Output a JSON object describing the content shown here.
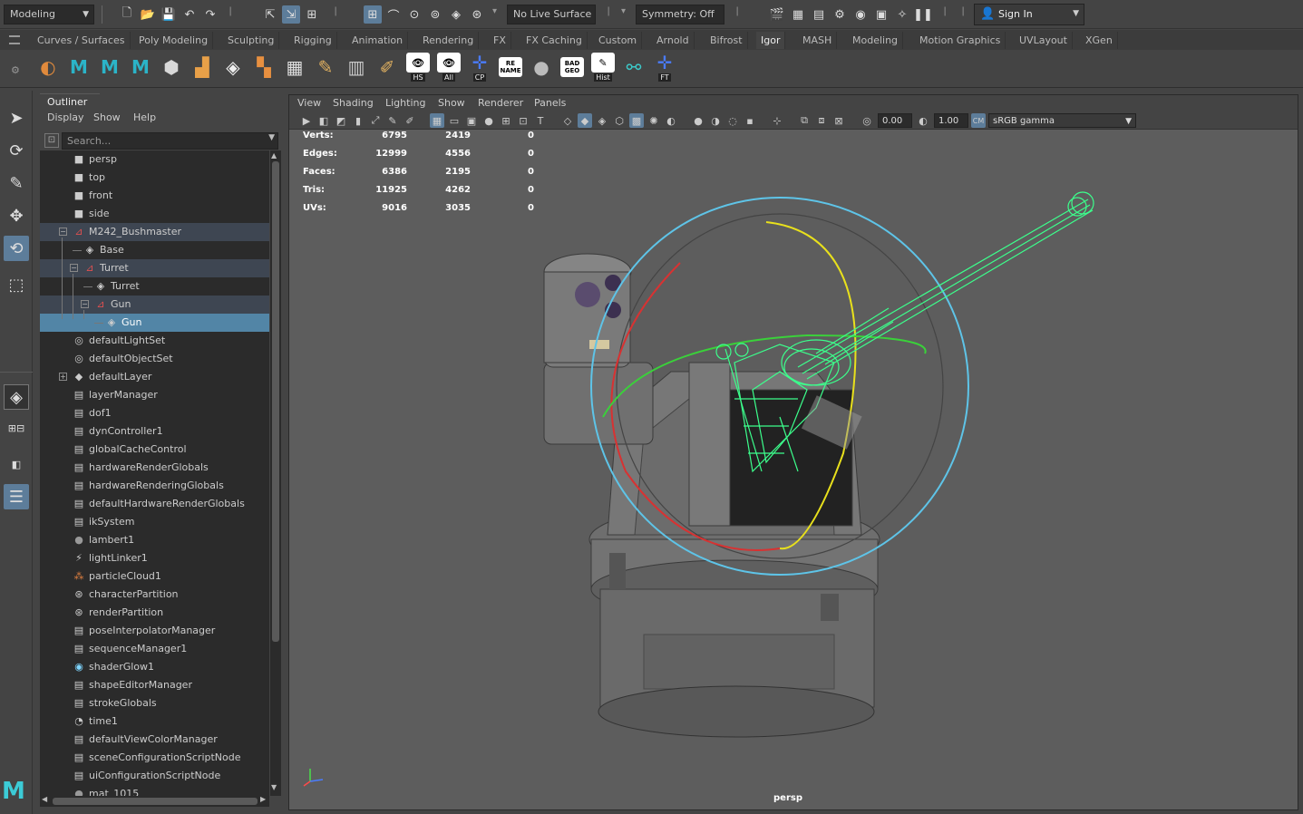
{
  "statusline": {
    "mode": "Modeling",
    "live_surface": "No Live Surface",
    "symmetry": "Symmetry: Off",
    "sign_in": "Sign In"
  },
  "shelf_tabs": [
    "Curves / Surfaces",
    "Poly Modeling",
    "Sculpting",
    "Rigging",
    "Animation",
    "Rendering",
    "FX",
    "FX Caching",
    "Custom",
    "Arnold",
    "Bifrost",
    "Igor",
    "MASH",
    "Modeling",
    "Motion Graphics",
    "UVLayout",
    "XGen"
  ],
  "active_shelf_tab": "Igor",
  "shelf_buttons": [
    {
      "icon": "shelf-ball-icon",
      "label": ""
    },
    {
      "icon": "shelf-m-icon-1",
      "label": ""
    },
    {
      "icon": "shelf-m-icon-2",
      "label": ""
    },
    {
      "icon": "shelf-m-icon-3",
      "label": ""
    },
    {
      "icon": "shelf-cube-icon",
      "label": ""
    },
    {
      "icon": "shelf-blocks-icon",
      "label": ""
    },
    {
      "icon": "shelf-layers-icon",
      "label": ""
    },
    {
      "icon": "shelf-squares-icon",
      "label": ""
    },
    {
      "icon": "shelf-grid-icon",
      "label": ""
    },
    {
      "icon": "shelf-pencil-icon",
      "label": ""
    },
    {
      "icon": "shelf-bars-icon",
      "label": ""
    },
    {
      "icon": "shelf-paint-icon",
      "label": ""
    },
    {
      "icon": "shelf-eye-icon",
      "label": "HS"
    },
    {
      "icon": "shelf-eye-all-icon",
      "label": "All"
    },
    {
      "icon": "shelf-axis-icon",
      "label": "CP"
    },
    {
      "icon": "shelf-rename-icon",
      "label": "",
      "text": "RE NAME"
    },
    {
      "icon": "shelf-sphere-icon",
      "label": ""
    },
    {
      "icon": "shelf-badgeo-icon",
      "label": "",
      "text": "BAD GEO"
    },
    {
      "icon": "shelf-hist-icon",
      "label": "Hist"
    },
    {
      "icon": "shelf-attach-icon",
      "label": ""
    },
    {
      "icon": "shelf-ft-icon",
      "label": "FT"
    }
  ],
  "outliner": {
    "tab": "Outliner",
    "menu": [
      "Display",
      "Show",
      "Help"
    ],
    "search_placeholder": "Search...",
    "rows": [
      {
        "label": "persp",
        "icon": "camera-icon",
        "indent": 0,
        "state": ""
      },
      {
        "label": "top",
        "icon": "camera-icon",
        "indent": 0,
        "state": ""
      },
      {
        "label": "front",
        "icon": "camera-icon",
        "indent": 0,
        "state": ""
      },
      {
        "label": "side",
        "icon": "camera-icon",
        "indent": 0,
        "state": ""
      },
      {
        "label": "M242_Bushmaster",
        "icon": "group-icon",
        "indent": 0,
        "state": "hl",
        "expander": "−"
      },
      {
        "label": "Base",
        "icon": "mesh-icon",
        "indent": 1,
        "state": ""
      },
      {
        "label": "Turret",
        "icon": "group-icon",
        "indent": 1,
        "state": "hl",
        "expander": "−"
      },
      {
        "label": "Turret",
        "icon": "mesh-icon",
        "indent": 2,
        "state": ""
      },
      {
        "label": "Gun",
        "icon": "group-icon",
        "indent": 2,
        "state": "hl",
        "expander": "−"
      },
      {
        "label": "Gun",
        "icon": "mesh-icon",
        "indent": 3,
        "state": "sel"
      },
      {
        "label": "defaultLightSet",
        "icon": "set-icon",
        "indent": 0,
        "state": ""
      },
      {
        "label": "defaultObjectSet",
        "icon": "set-icon",
        "indent": 0,
        "state": ""
      },
      {
        "label": "defaultLayer",
        "icon": "layer-icon",
        "indent": 0,
        "state": "",
        "expander": "+"
      },
      {
        "label": "layerManager",
        "icon": "node-icon",
        "indent": 0,
        "state": ""
      },
      {
        "label": "dof1",
        "icon": "node-icon",
        "indent": 0,
        "state": ""
      },
      {
        "label": "dynController1",
        "icon": "node-icon",
        "indent": 0,
        "state": ""
      },
      {
        "label": "globalCacheControl",
        "icon": "node-icon",
        "indent": 0,
        "state": ""
      },
      {
        "label": "hardwareRenderGlobals",
        "icon": "node-icon",
        "indent": 0,
        "state": ""
      },
      {
        "label": "hardwareRenderingGlobals",
        "icon": "node-icon",
        "indent": 0,
        "state": ""
      },
      {
        "label": "defaultHardwareRenderGlobals",
        "icon": "node-icon",
        "indent": 0,
        "state": ""
      },
      {
        "label": "ikSystem",
        "icon": "node-icon",
        "indent": 0,
        "state": ""
      },
      {
        "label": "lambert1",
        "icon": "material-icon",
        "indent": 0,
        "state": ""
      },
      {
        "label": "lightLinker1",
        "icon": "light-linker-icon",
        "indent": 0,
        "state": ""
      },
      {
        "label": "particleCloud1",
        "icon": "particle-icon",
        "indent": 0,
        "state": ""
      },
      {
        "label": "characterPartition",
        "icon": "partition-icon",
        "indent": 0,
        "state": ""
      },
      {
        "label": "renderPartition",
        "icon": "partition-icon",
        "indent": 0,
        "state": ""
      },
      {
        "label": "poseInterpolatorManager",
        "icon": "node-icon",
        "indent": 0,
        "state": ""
      },
      {
        "label": "sequenceManager1",
        "icon": "node-icon",
        "indent": 0,
        "state": ""
      },
      {
        "label": "shaderGlow1",
        "icon": "glow-icon",
        "indent": 0,
        "state": ""
      },
      {
        "label": "shapeEditorManager",
        "icon": "node-icon",
        "indent": 0,
        "state": ""
      },
      {
        "label": "strokeGlobals",
        "icon": "node-icon",
        "indent": 0,
        "state": ""
      },
      {
        "label": "time1",
        "icon": "clock-icon",
        "indent": 0,
        "state": ""
      },
      {
        "label": "defaultViewColorManager",
        "icon": "node-icon",
        "indent": 0,
        "state": ""
      },
      {
        "label": "sceneConfigurationScriptNode",
        "icon": "node-icon",
        "indent": 0,
        "state": ""
      },
      {
        "label": "uiConfigurationScriptNode",
        "icon": "node-icon",
        "indent": 0,
        "state": ""
      },
      {
        "label": "mat_1015",
        "icon": "material-icon",
        "indent": 0,
        "state": ""
      }
    ]
  },
  "viewport": {
    "menu": [
      "View",
      "Shading",
      "Lighting",
      "Show",
      "Renderer",
      "Panels"
    ],
    "exposure": "0.00",
    "gamma": "1.00",
    "color_space": "sRGB gamma",
    "camera_label": "persp",
    "hud": [
      {
        "label": "Verts:",
        "a": "6795",
        "b": "2419",
        "c": "0"
      },
      {
        "label": "Edges:",
        "a": "12999",
        "b": "4556",
        "c": "0"
      },
      {
        "label": "Faces:",
        "a": "6386",
        "b": "2195",
        "c": "0"
      },
      {
        "label": "Tris:",
        "a": "11925",
        "b": "4262",
        "c": "0"
      },
      {
        "label": "UVs:",
        "a": "9016",
        "b": "3035",
        "c": "0"
      }
    ]
  },
  "colors": {
    "selection": "#5285a6",
    "active_tool": "#5d7d9a",
    "wireframe": "#3cff8c",
    "viewport_bg": "#5d5d5d"
  }
}
